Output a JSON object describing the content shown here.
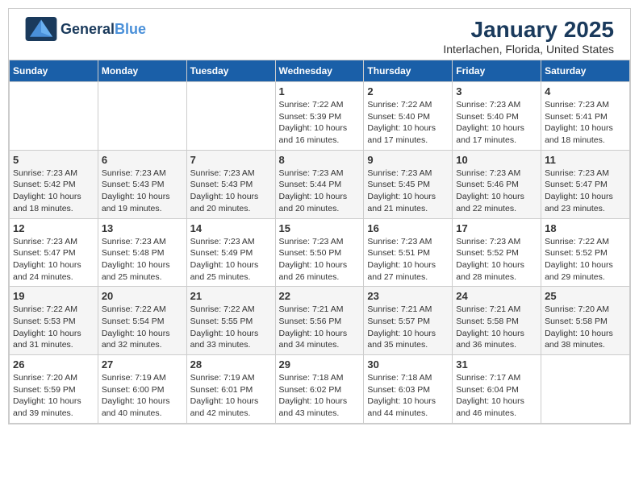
{
  "header": {
    "logo_line1": "General",
    "logo_line2": "Blue",
    "title": "January 2025",
    "subtitle": "Interlachen, Florida, United States"
  },
  "weekdays": [
    "Sunday",
    "Monday",
    "Tuesday",
    "Wednesday",
    "Thursday",
    "Friday",
    "Saturday"
  ],
  "weeks": [
    [
      {
        "day": "",
        "detail": ""
      },
      {
        "day": "",
        "detail": ""
      },
      {
        "day": "",
        "detail": ""
      },
      {
        "day": "1",
        "detail": "Sunrise: 7:22 AM\nSunset: 5:39 PM\nDaylight: 10 hours\nand 16 minutes."
      },
      {
        "day": "2",
        "detail": "Sunrise: 7:22 AM\nSunset: 5:40 PM\nDaylight: 10 hours\nand 17 minutes."
      },
      {
        "day": "3",
        "detail": "Sunrise: 7:23 AM\nSunset: 5:40 PM\nDaylight: 10 hours\nand 17 minutes."
      },
      {
        "day": "4",
        "detail": "Sunrise: 7:23 AM\nSunset: 5:41 PM\nDaylight: 10 hours\nand 18 minutes."
      }
    ],
    [
      {
        "day": "5",
        "detail": "Sunrise: 7:23 AM\nSunset: 5:42 PM\nDaylight: 10 hours\nand 18 minutes."
      },
      {
        "day": "6",
        "detail": "Sunrise: 7:23 AM\nSunset: 5:43 PM\nDaylight: 10 hours\nand 19 minutes."
      },
      {
        "day": "7",
        "detail": "Sunrise: 7:23 AM\nSunset: 5:43 PM\nDaylight: 10 hours\nand 20 minutes."
      },
      {
        "day": "8",
        "detail": "Sunrise: 7:23 AM\nSunset: 5:44 PM\nDaylight: 10 hours\nand 20 minutes."
      },
      {
        "day": "9",
        "detail": "Sunrise: 7:23 AM\nSunset: 5:45 PM\nDaylight: 10 hours\nand 21 minutes."
      },
      {
        "day": "10",
        "detail": "Sunrise: 7:23 AM\nSunset: 5:46 PM\nDaylight: 10 hours\nand 22 minutes."
      },
      {
        "day": "11",
        "detail": "Sunrise: 7:23 AM\nSunset: 5:47 PM\nDaylight: 10 hours\nand 23 minutes."
      }
    ],
    [
      {
        "day": "12",
        "detail": "Sunrise: 7:23 AM\nSunset: 5:47 PM\nDaylight: 10 hours\nand 24 minutes."
      },
      {
        "day": "13",
        "detail": "Sunrise: 7:23 AM\nSunset: 5:48 PM\nDaylight: 10 hours\nand 25 minutes."
      },
      {
        "day": "14",
        "detail": "Sunrise: 7:23 AM\nSunset: 5:49 PM\nDaylight: 10 hours\nand 25 minutes."
      },
      {
        "day": "15",
        "detail": "Sunrise: 7:23 AM\nSunset: 5:50 PM\nDaylight: 10 hours\nand 26 minutes."
      },
      {
        "day": "16",
        "detail": "Sunrise: 7:23 AM\nSunset: 5:51 PM\nDaylight: 10 hours\nand 27 minutes."
      },
      {
        "day": "17",
        "detail": "Sunrise: 7:23 AM\nSunset: 5:52 PM\nDaylight: 10 hours\nand 28 minutes."
      },
      {
        "day": "18",
        "detail": "Sunrise: 7:22 AM\nSunset: 5:52 PM\nDaylight: 10 hours\nand 29 minutes."
      }
    ],
    [
      {
        "day": "19",
        "detail": "Sunrise: 7:22 AM\nSunset: 5:53 PM\nDaylight: 10 hours\nand 31 minutes."
      },
      {
        "day": "20",
        "detail": "Sunrise: 7:22 AM\nSunset: 5:54 PM\nDaylight: 10 hours\nand 32 minutes."
      },
      {
        "day": "21",
        "detail": "Sunrise: 7:22 AM\nSunset: 5:55 PM\nDaylight: 10 hours\nand 33 minutes."
      },
      {
        "day": "22",
        "detail": "Sunrise: 7:21 AM\nSunset: 5:56 PM\nDaylight: 10 hours\nand 34 minutes."
      },
      {
        "day": "23",
        "detail": "Sunrise: 7:21 AM\nSunset: 5:57 PM\nDaylight: 10 hours\nand 35 minutes."
      },
      {
        "day": "24",
        "detail": "Sunrise: 7:21 AM\nSunset: 5:58 PM\nDaylight: 10 hours\nand 36 minutes."
      },
      {
        "day": "25",
        "detail": "Sunrise: 7:20 AM\nSunset: 5:58 PM\nDaylight: 10 hours\nand 38 minutes."
      }
    ],
    [
      {
        "day": "26",
        "detail": "Sunrise: 7:20 AM\nSunset: 5:59 PM\nDaylight: 10 hours\nand 39 minutes."
      },
      {
        "day": "27",
        "detail": "Sunrise: 7:19 AM\nSunset: 6:00 PM\nDaylight: 10 hours\nand 40 minutes."
      },
      {
        "day": "28",
        "detail": "Sunrise: 7:19 AM\nSunset: 6:01 PM\nDaylight: 10 hours\nand 42 minutes."
      },
      {
        "day": "29",
        "detail": "Sunrise: 7:18 AM\nSunset: 6:02 PM\nDaylight: 10 hours\nand 43 minutes."
      },
      {
        "day": "30",
        "detail": "Sunrise: 7:18 AM\nSunset: 6:03 PM\nDaylight: 10 hours\nand 44 minutes."
      },
      {
        "day": "31",
        "detail": "Sunrise: 7:17 AM\nSunset: 6:04 PM\nDaylight: 10 hours\nand 46 minutes."
      },
      {
        "day": "",
        "detail": ""
      }
    ]
  ]
}
